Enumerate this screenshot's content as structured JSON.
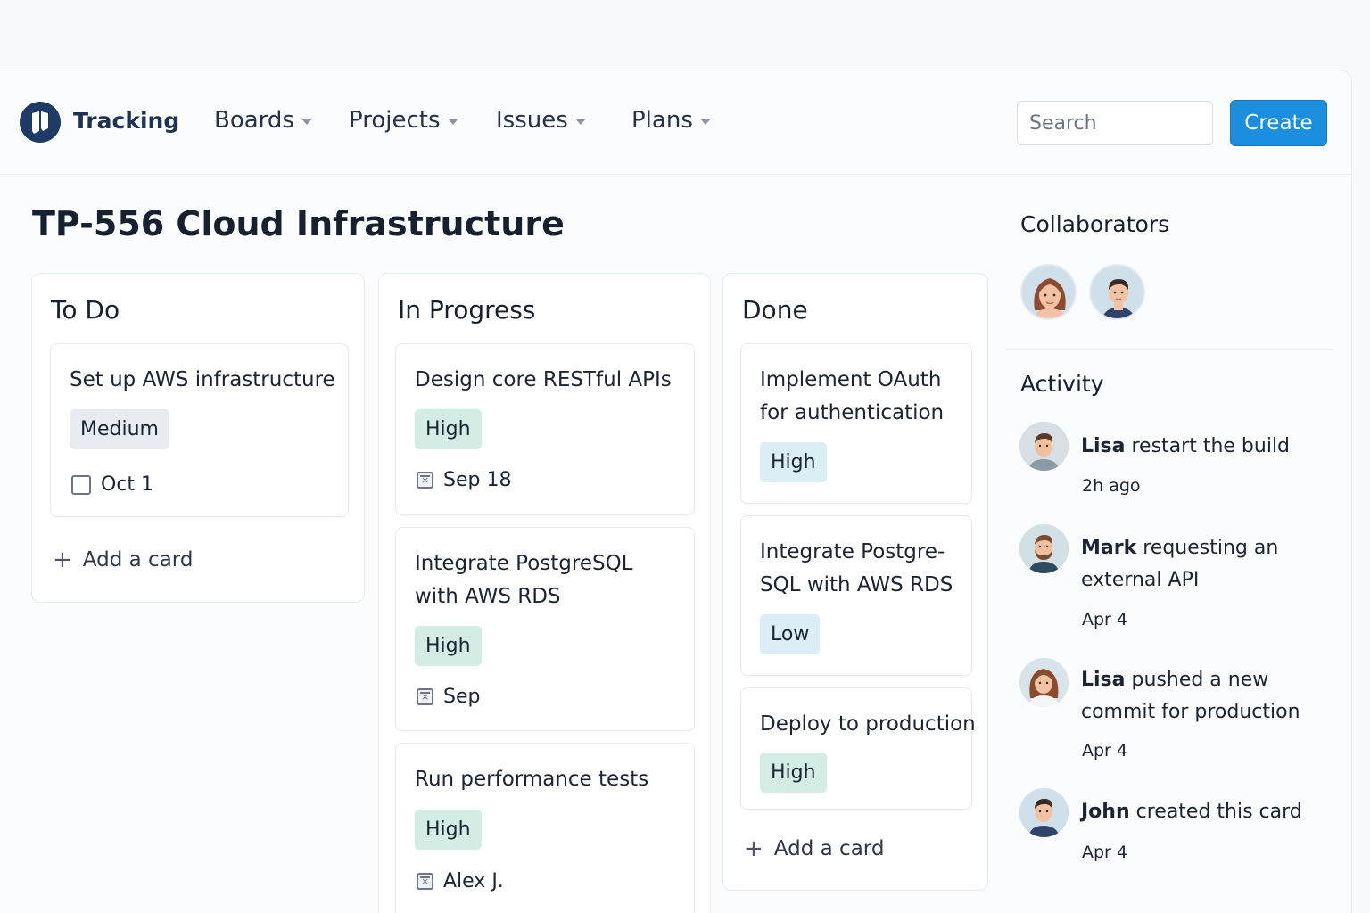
{
  "header": {
    "brand": "Tracking",
    "nav": [
      {
        "label": "Boards"
      },
      {
        "label": "Projects"
      },
      {
        "label": "Issues"
      },
      {
        "label": "Plans"
      }
    ],
    "search_placeholder": "Search",
    "create_label": "Create"
  },
  "page_title": "TP-556 Cloud Infrastructure",
  "columns": [
    {
      "title": "To Do",
      "cards": [
        {
          "title_lines": [
            "Set up AWS infrastructure"
          ],
          "tag": "Medium",
          "meta": "Oct 1",
          "meta_icon": "checkbox-icon"
        }
      ],
      "add_label": "Add a card"
    },
    {
      "title": "In Progress",
      "cards": [
        {
          "title_lines": [
            "Design core RESTful APIs"
          ],
          "tag": "High",
          "meta": "Sep 18",
          "meta_icon": "calendar-icon"
        },
        {
          "title_lines": [
            "Integrate PostgreSQL",
            "with AWS RDS"
          ],
          "tag": "High",
          "meta": "Sep",
          "meta_icon": "calendar-icon"
        },
        {
          "title_lines": [
            "Run performance tests"
          ],
          "tag": "High",
          "meta": "Alex J.",
          "meta_icon": "calendar-icon"
        }
      ]
    },
    {
      "title": "Done",
      "cards": [
        {
          "title_lines": [
            "Implement OAuth",
            "for authentication"
          ],
          "tag": "High"
        },
        {
          "title_lines": [
            "Integrate Postgre-",
            "SQL with AWS RDS"
          ],
          "tag": "Low"
        },
        {
          "title_lines": [
            "Deploy to production"
          ],
          "tag": "High"
        }
      ],
      "add_label": "Add a card"
    }
  ],
  "sidebar": {
    "collaborators_heading": "Collaborators",
    "collaborators": [
      {
        "avatar": "woman-avatar"
      },
      {
        "avatar": "man-avatar"
      }
    ],
    "activity_heading": "Activity",
    "activity": [
      {
        "user": "Lisa",
        "action_lines": [
          "restart the build"
        ],
        "time": "2h ago",
        "avatar": "man-avatar"
      },
      {
        "user": "Mark",
        "action_lines": [
          "requesting an",
          "external API"
        ],
        "time": "Apr 4",
        "avatar": "bearded-man-avatar"
      },
      {
        "user": "Lisa",
        "action_lines": [
          "pushed a new",
          "commit for production"
        ],
        "time": "Apr 4",
        "avatar": "woman-avatar"
      },
      {
        "user": "John",
        "action_lines": [
          "created this card"
        ],
        "time": "Apr 4",
        "avatar": "man-avatar"
      }
    ]
  },
  "colors": {
    "accent": "#1c8ee0",
    "brand": "#1f3a66",
    "tag_high": "#d3ede4",
    "tag_low": "#dcedf5",
    "tag_medium": "#e8ecf1"
  }
}
